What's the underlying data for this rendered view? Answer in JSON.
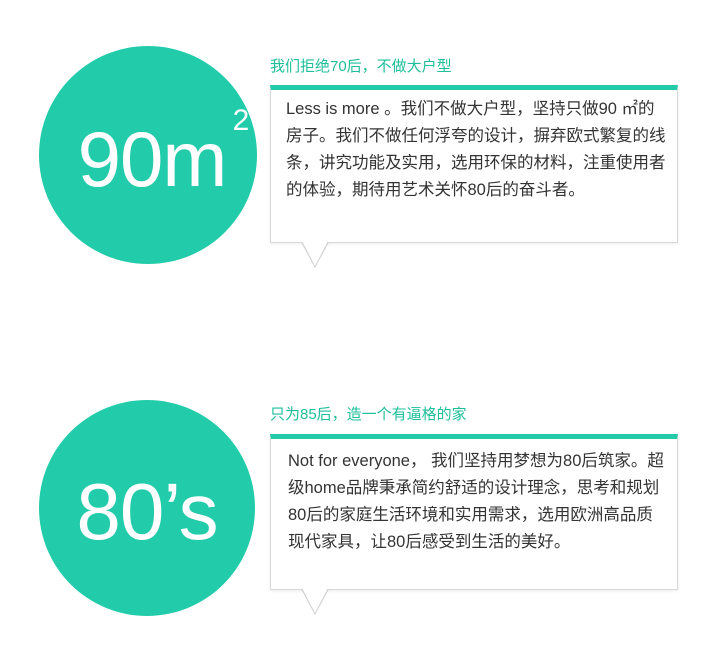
{
  "section1": {
    "circle_number": "90m",
    "circle_superscript": "2",
    "heading": "我们拒绝70后，不做大户型",
    "body": "Less is more 。我们不做大户型，坚持只做90 ㎡的房子。我们不做任何浮夸的设计，摒弃欧式繁复的线条，讲究功能及实用，选用环保的材料，注重使用者的体验，期待用艺术关怀80后的奋斗者。"
  },
  "section2": {
    "circle_text": "80’s",
    "heading": "只为85后，造一个有逼格的家",
    "body": "Not for everyone， 我们坚持用梦想为80后筑家。超级home品牌秉承简约舒适的设计理念，思考和规划80后的家庭生活环境和实用需求，选用欧洲高品质现代家具，让80后感受到生活的美好。"
  },
  "colors": {
    "accent": "#22ccaa",
    "heading": "#1fbf9c",
    "text": "#333333"
  }
}
